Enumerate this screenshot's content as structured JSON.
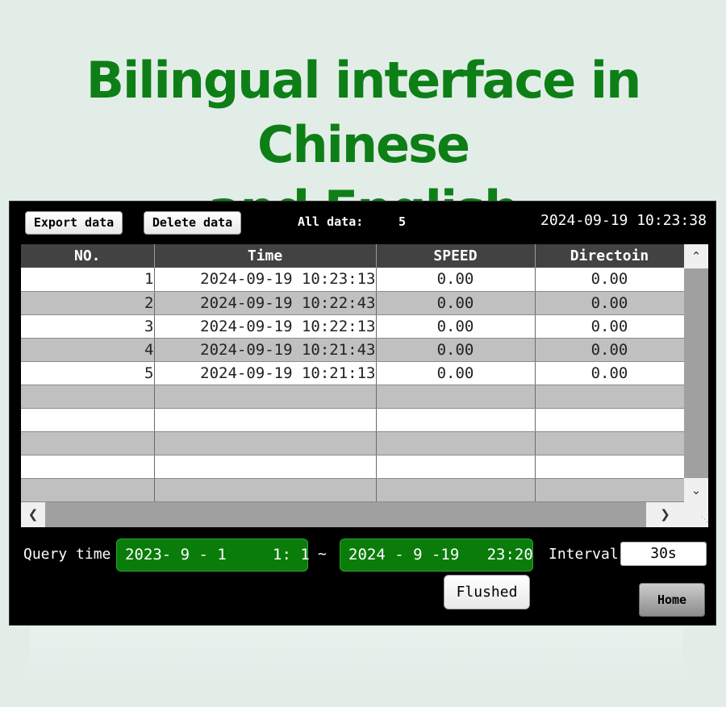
{
  "banner": {
    "line1": "Bilingual interface in Chinese",
    "line2": "and English",
    "color": "#0d7f16"
  },
  "toolbar": {
    "export_label": "Export data",
    "delete_label": "Delete data",
    "all_data_label": "All data:",
    "all_data_count": "5",
    "clock": "2024-09-19 10:23:38"
  },
  "table": {
    "headers": [
      "NO.",
      "Time",
      "SPEED",
      "Directoin"
    ],
    "rows": [
      {
        "no": "1",
        "time": "2024-09-19 10:23:13",
        "speed": "0.00",
        "direction": "0.00"
      },
      {
        "no": "2",
        "time": "2024-09-19 10:22:43",
        "speed": "0.00",
        "direction": "0.00"
      },
      {
        "no": "3",
        "time": "2024-09-19 10:22:13",
        "speed": "0.00",
        "direction": "0.00"
      },
      {
        "no": "4",
        "time": "2024-09-19 10:21:43",
        "speed": "0.00",
        "direction": "0.00"
      },
      {
        "no": "5",
        "time": "2024-09-19 10:21:13",
        "speed": "0.00",
        "direction": "0.00"
      },
      {
        "no": "",
        "time": "",
        "speed": "",
        "direction": ""
      },
      {
        "no": "",
        "time": "",
        "speed": "",
        "direction": ""
      },
      {
        "no": "",
        "time": "",
        "speed": "",
        "direction": ""
      },
      {
        "no": "",
        "time": "",
        "speed": "",
        "direction": ""
      },
      {
        "no": "",
        "time": "",
        "speed": "",
        "direction": ""
      }
    ]
  },
  "icons": {
    "scroll_up": "chevron-up-icon",
    "scroll_down": "chevron-down-icon",
    "scroll_left": "chevron-left-icon",
    "scroll_right": "chevron-right-icon"
  },
  "query": {
    "label": "Query time",
    "from": "2023- 9 - 1     1: 1",
    "separator": "~",
    "to": "2024 - 9 -19   23:20",
    "interval_label": "Interval",
    "interval_value": "30s",
    "flushed_label": "Flushed",
    "home_label": "Home",
    "accent": "#0a7c0a"
  }
}
